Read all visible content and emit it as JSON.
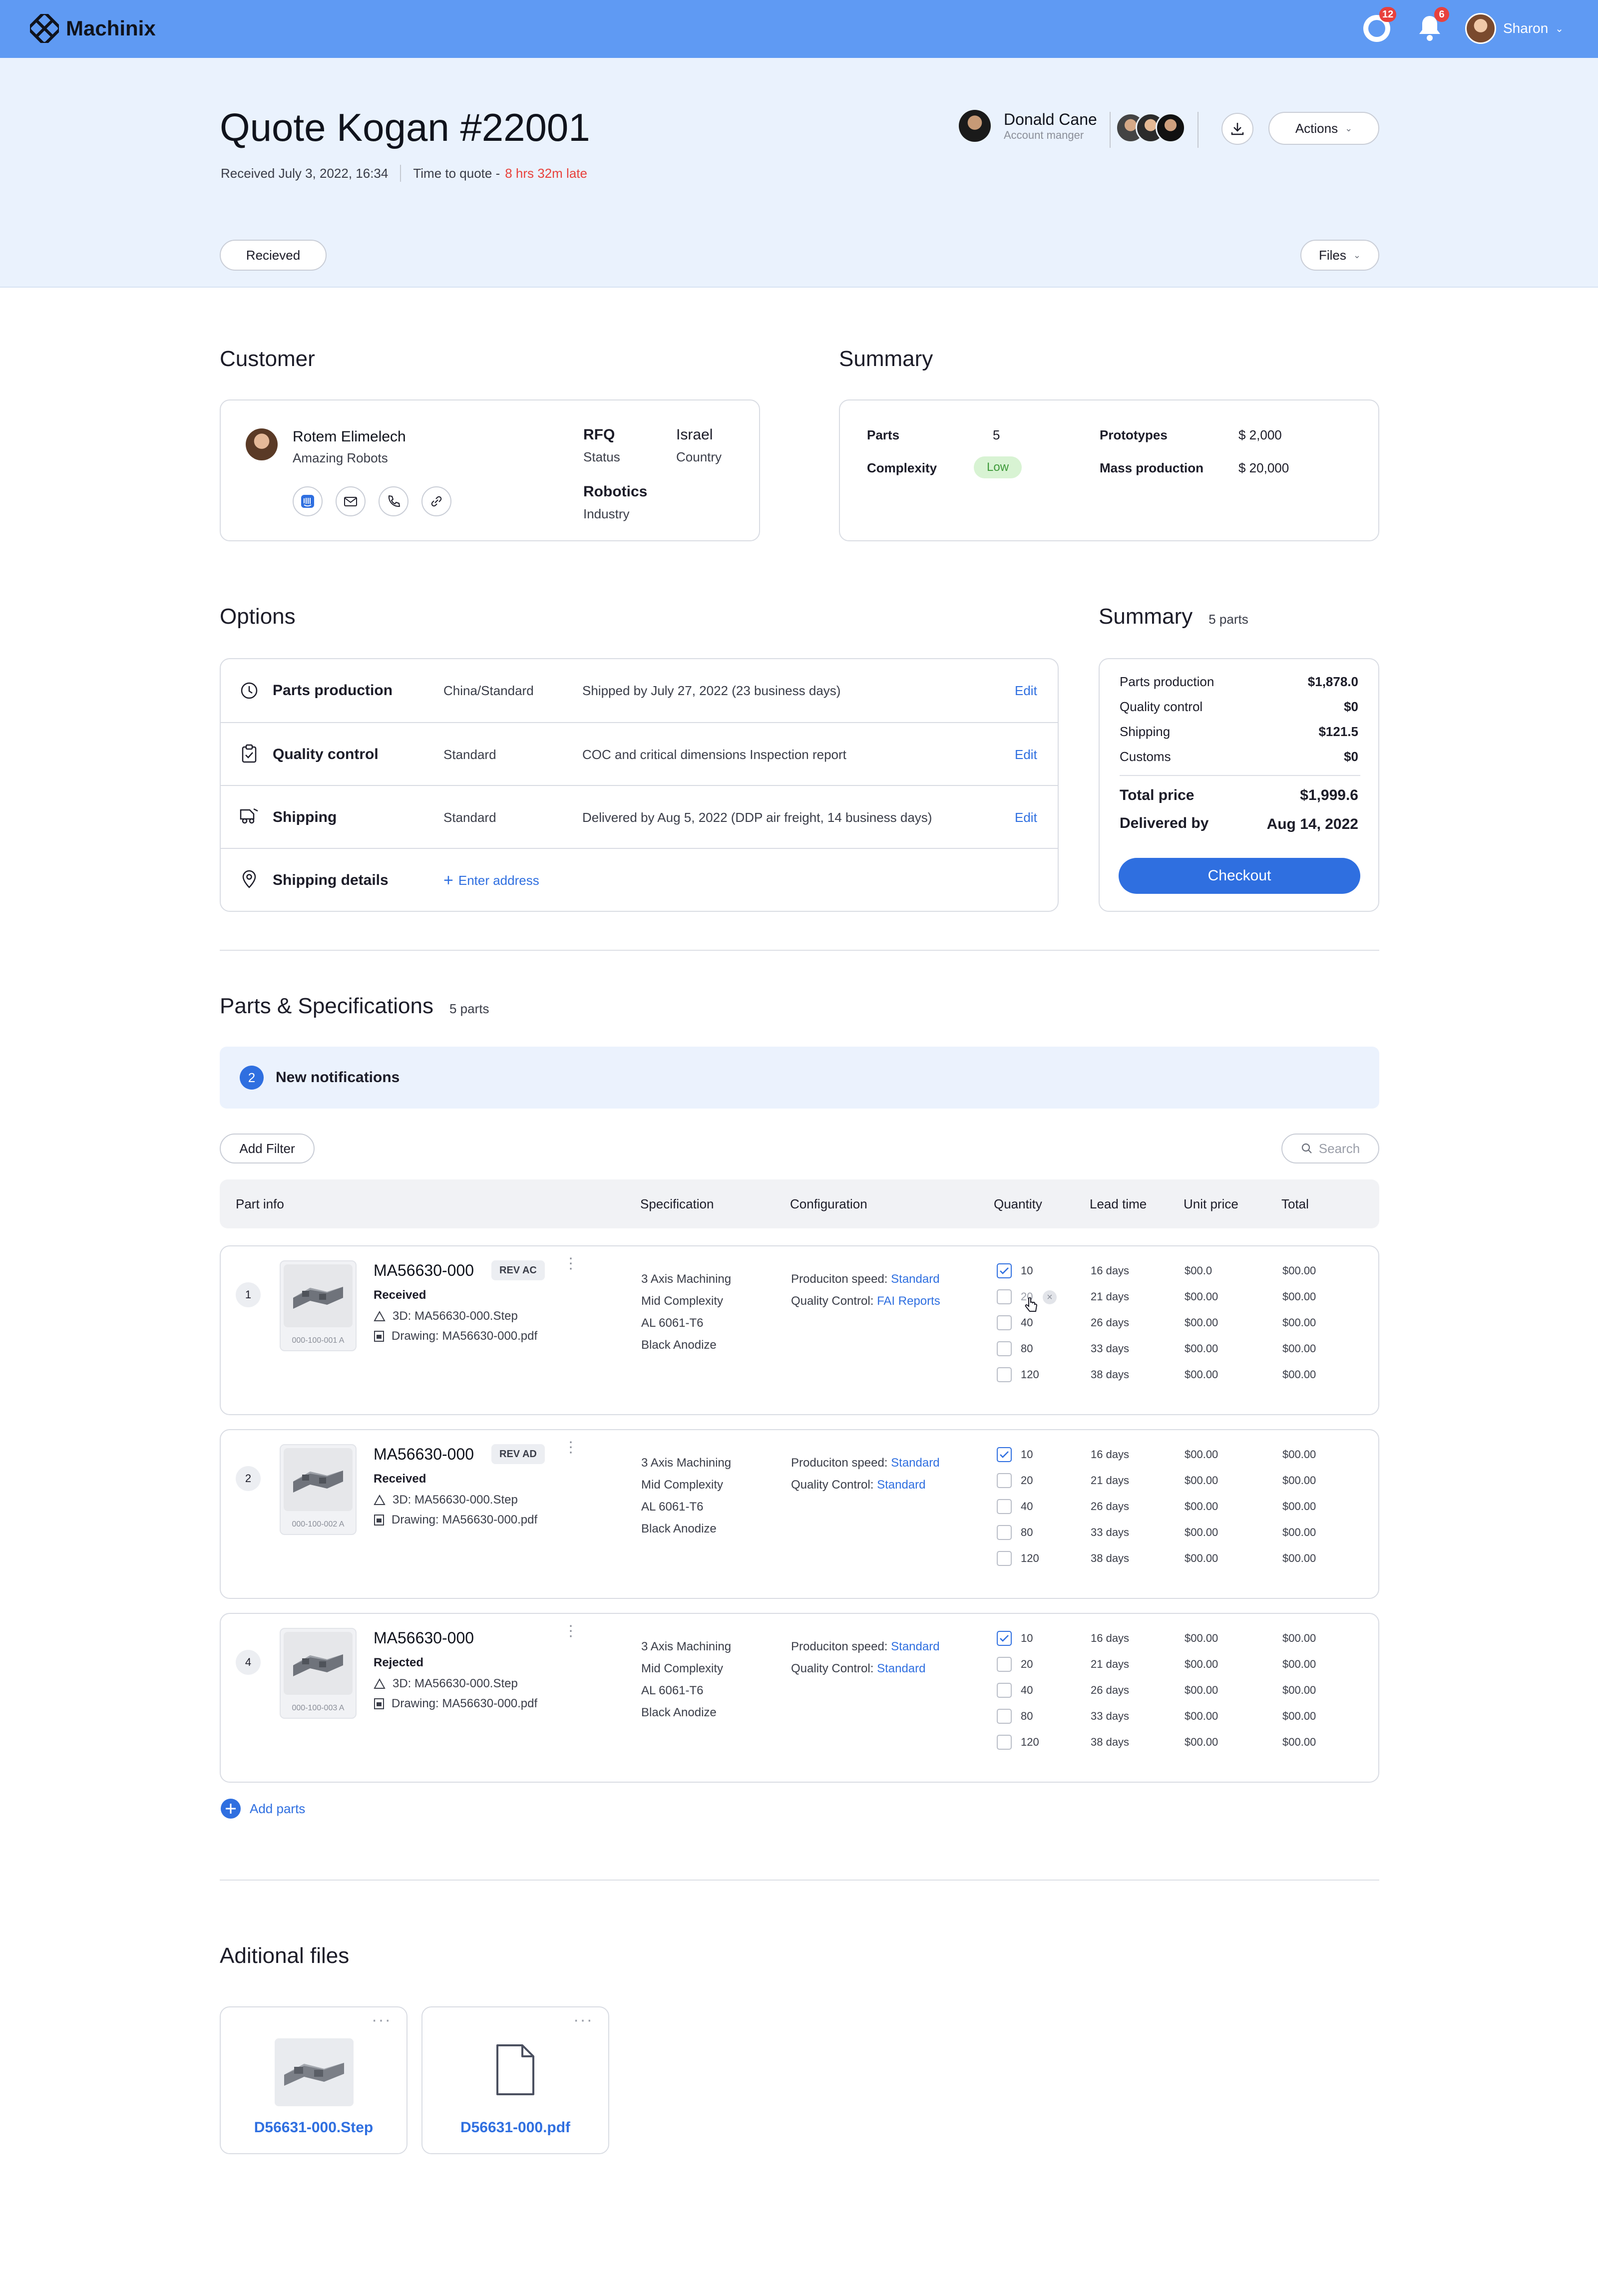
{
  "app": {
    "brand": "Machinix",
    "user_name": "Sharon",
    "chat_badge": "12",
    "notif_badge": "6"
  },
  "header": {
    "title": "Quote Kogan #22001",
    "received": "Received July 3, 2022, 16:34",
    "time_to_quote_label": "Time to quote -",
    "time_to_quote_value": "8 hrs 32m late",
    "manager_name": "Donald Cane",
    "manager_role": "Account manger",
    "actions_label": "Actions",
    "status_label": "Recieved",
    "files_label": "Files"
  },
  "customer": {
    "heading": "Customer",
    "name": "Rotem Elimelech",
    "company": "Amazing Robots",
    "status_value": "RFQ",
    "status_label": "Status",
    "country_value": "Israel",
    "country_label": "Country",
    "industry_value": "Robotics",
    "industry_label": "Industry"
  },
  "summary_top": {
    "heading": "Summary",
    "parts_label": "Parts",
    "parts_value": "5",
    "complexity_label": "Complexity",
    "complexity_value": "Low",
    "prototypes_label": "Prototypes",
    "prototypes_value": "$ 2,000",
    "mass_label": "Mass production",
    "mass_value": "$ 20,000"
  },
  "options": {
    "heading": "Options",
    "rows": [
      {
        "name": "Parts production",
        "value": "China/Standard",
        "detail": "Shipped by July 27, 2022 (23 business days)",
        "action": "Edit"
      },
      {
        "name": "Quality control",
        "value": "Standard",
        "detail": "COC and critical dimensions Inspection report",
        "action": "Edit"
      },
      {
        "name": "Shipping",
        "value": "Standard",
        "detail": "Delivered by Aug 5, 2022 (DDP air freight, 14 business days)",
        "action": "Edit"
      },
      {
        "name": "Shipping details",
        "value": "Enter address",
        "detail": "",
        "action": ""
      }
    ]
  },
  "order_summary": {
    "heading": "Summary",
    "count": "5 parts",
    "lines": [
      {
        "label": "Parts production",
        "value": "$1,878.0"
      },
      {
        "label": "Quality control",
        "value": "$0"
      },
      {
        "label": "Shipping",
        "value": "$121.5"
      },
      {
        "label": "Customs",
        "value": "$0"
      }
    ],
    "total_label": "Total price",
    "total_value": "$1,999.6",
    "delivered_label": "Delivered by",
    "delivered_value": "Aug 14, 2022",
    "checkout_label": "Checkout"
  },
  "parts": {
    "heading": "Parts & Specifications",
    "count": "5 parts",
    "notif_count": "2",
    "notif_label": "New notifications",
    "filter_label": "Add Filter",
    "search_placeholder": "Search",
    "columns": [
      "Part info",
      "Specification",
      "Configuration",
      "Quantity",
      "Lead time",
      "Unit price",
      "Total"
    ],
    "cfg_speed_label": "Produciton speed:",
    "cfg_qc_label": "Quality Control:",
    "items": [
      {
        "index": "1",
        "name": "MA56630-000",
        "rev": "REV AC",
        "status": "Received",
        "file3d": "3D: MA56630-000.Step",
        "drawing": "Drawing: MA56630-000.pdf",
        "thumb_label": "000-100-001 A",
        "spec": [
          "3 Axis Machining",
          "Mid Complexity",
          "AL 6061-T6",
          "Black Anodize"
        ],
        "speed": "Standard",
        "qc": "FAI Reports",
        "rows": [
          {
            "q": "10",
            "lead": "16 days",
            "unit": "$00.0",
            "total": "$00.00"
          },
          {
            "q": "20",
            "lead": "21 days",
            "unit": "$00.00",
            "total": "$00.00"
          },
          {
            "q": "40",
            "lead": "26 days",
            "unit": "$00.00",
            "total": "$00.00"
          },
          {
            "q": "80",
            "lead": "33 days",
            "unit": "$00.00",
            "total": "$00.00"
          },
          {
            "q": "120",
            "lead": "38 days",
            "unit": "$00.00",
            "total": "$00.00"
          }
        ]
      },
      {
        "index": "2",
        "name": "MA56630-000",
        "rev": "REV AD",
        "status": "Received",
        "file3d": "3D: MA56630-000.Step",
        "drawing": "Drawing: MA56630-000.pdf",
        "thumb_label": "000-100-002 A",
        "spec": [
          "3 Axis Machining",
          "Mid Complexity",
          "AL 6061-T6",
          "Black Anodize"
        ],
        "speed": "Standard",
        "qc": "Standard",
        "rows": [
          {
            "q": "10",
            "lead": "16 days",
            "unit": "$00.00",
            "total": "$00.00"
          },
          {
            "q": "20",
            "lead": "21 days",
            "unit": "$00.00",
            "total": "$00.00"
          },
          {
            "q": "40",
            "lead": "26 days",
            "unit": "$00.00",
            "total": "$00.00"
          },
          {
            "q": "80",
            "lead": "33 days",
            "unit": "$00.00",
            "total": "$00.00"
          },
          {
            "q": "120",
            "lead": "38 days",
            "unit": "$00.00",
            "total": "$00.00"
          }
        ]
      },
      {
        "index": "4",
        "name": "MA56630-000",
        "rev": "",
        "status": "Rejected",
        "file3d": "3D: MA56630-000.Step",
        "drawing": "Drawing: MA56630-000.pdf",
        "thumb_label": "000-100-003 A",
        "spec": [
          "3 Axis Machining",
          "Mid Complexity",
          "AL 6061-T6",
          "Black Anodize"
        ],
        "speed": "Standard",
        "qc": "Standard",
        "rows": [
          {
            "q": "10",
            "lead": "16 days",
            "unit": "$00.00",
            "total": "$00.00"
          },
          {
            "q": "20",
            "lead": "21 days",
            "unit": "$00.00",
            "total": "$00.00"
          },
          {
            "q": "40",
            "lead": "26 days",
            "unit": "$00.00",
            "total": "$00.00"
          },
          {
            "q": "80",
            "lead": "33 days",
            "unit": "$00.00",
            "total": "$00.00"
          },
          {
            "q": "120",
            "lead": "38 days",
            "unit": "$00.00",
            "total": "$00.00"
          }
        ]
      }
    ],
    "add_parts_label": "Add parts"
  },
  "files": {
    "heading": "Aditional files",
    "items": [
      {
        "name": "D56631-000.Step"
      },
      {
        "name": "D56631-000.pdf"
      }
    ]
  },
  "colors": {
    "primary": "#2f6fe0",
    "topbar": "#5f9af3",
    "hero": "#eaf2fd",
    "late": "#e8413c",
    "low_badge": "#d8f3d3"
  }
}
